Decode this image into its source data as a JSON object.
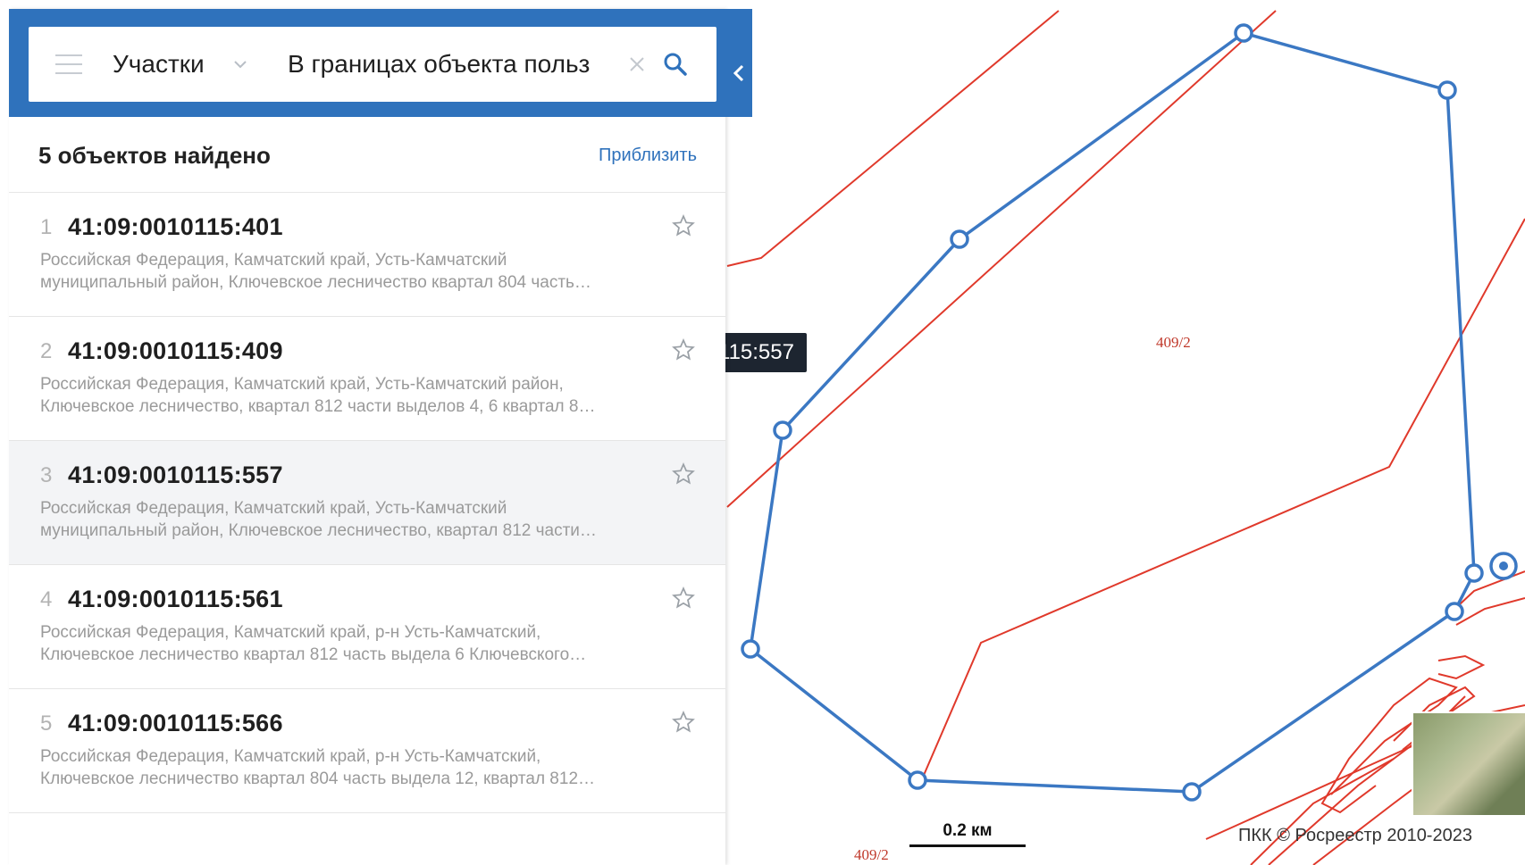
{
  "search": {
    "layer_label": "Участки",
    "query_value": "В границах объекта польз",
    "icons": {
      "menu": "menu-icon",
      "chevron": "chevron-down-icon",
      "clear": "close-icon",
      "search": "search-icon",
      "collapse": "chevron-left-icon"
    }
  },
  "results": {
    "count_text": "5 объектов найдено",
    "zoom_label": "Приблизить",
    "items": [
      {
        "num": "1",
        "cadastral": "41:09:0010115:401",
        "addr_line1": "Российская Федерация, Камчатский край, Усть-Камчатский",
        "addr_line2": "муниципальный район, Ключевское лесничество квартал 804 часть…",
        "active": false
      },
      {
        "num": "2",
        "cadastral": "41:09:0010115:409",
        "addr_line1": "Российская Федерация, Камчатский край, Усть-Камчатский район,",
        "addr_line2": "Ключевское лесничество, квартал 812 части выделов 4, 6 квартал 8…",
        "active": false
      },
      {
        "num": "3",
        "cadastral": "41:09:0010115:557",
        "addr_line1": "Российская Федерация, Камчатский край, Усть-Камчатский",
        "addr_line2": "муниципальный район, Ключевское лесничество, квартал 812 части…",
        "active": true
      },
      {
        "num": "4",
        "cadastral": "41:09:0010115:561",
        "addr_line1": "Российская Федерация, Камчатский край, р-н Усть-Камчатский,",
        "addr_line2": "Ключевское лесничество квартал 812 часть выдела 6 Ключевского…",
        "active": false
      },
      {
        "num": "5",
        "cadastral": "41:09:0010115:566",
        "addr_line1": "Российская Федерация, Камчатский край, р-н Усть-Камчатский,",
        "addr_line2": "Ключевское лесничество квартал 804 часть выдела 12, квартал 812…",
        "active": false
      }
    ]
  },
  "map": {
    "tooltip": "115:557",
    "parcel_label_1": "409/2",
    "parcel_label_2": "409/2",
    "scale_label": "0.2 км",
    "copyright": "ПКК © Росреестр 2010-2023",
    "colors": {
      "boundary": "#e0392b",
      "selection": "#3b78c3",
      "header": "#2f72bc"
    }
  }
}
